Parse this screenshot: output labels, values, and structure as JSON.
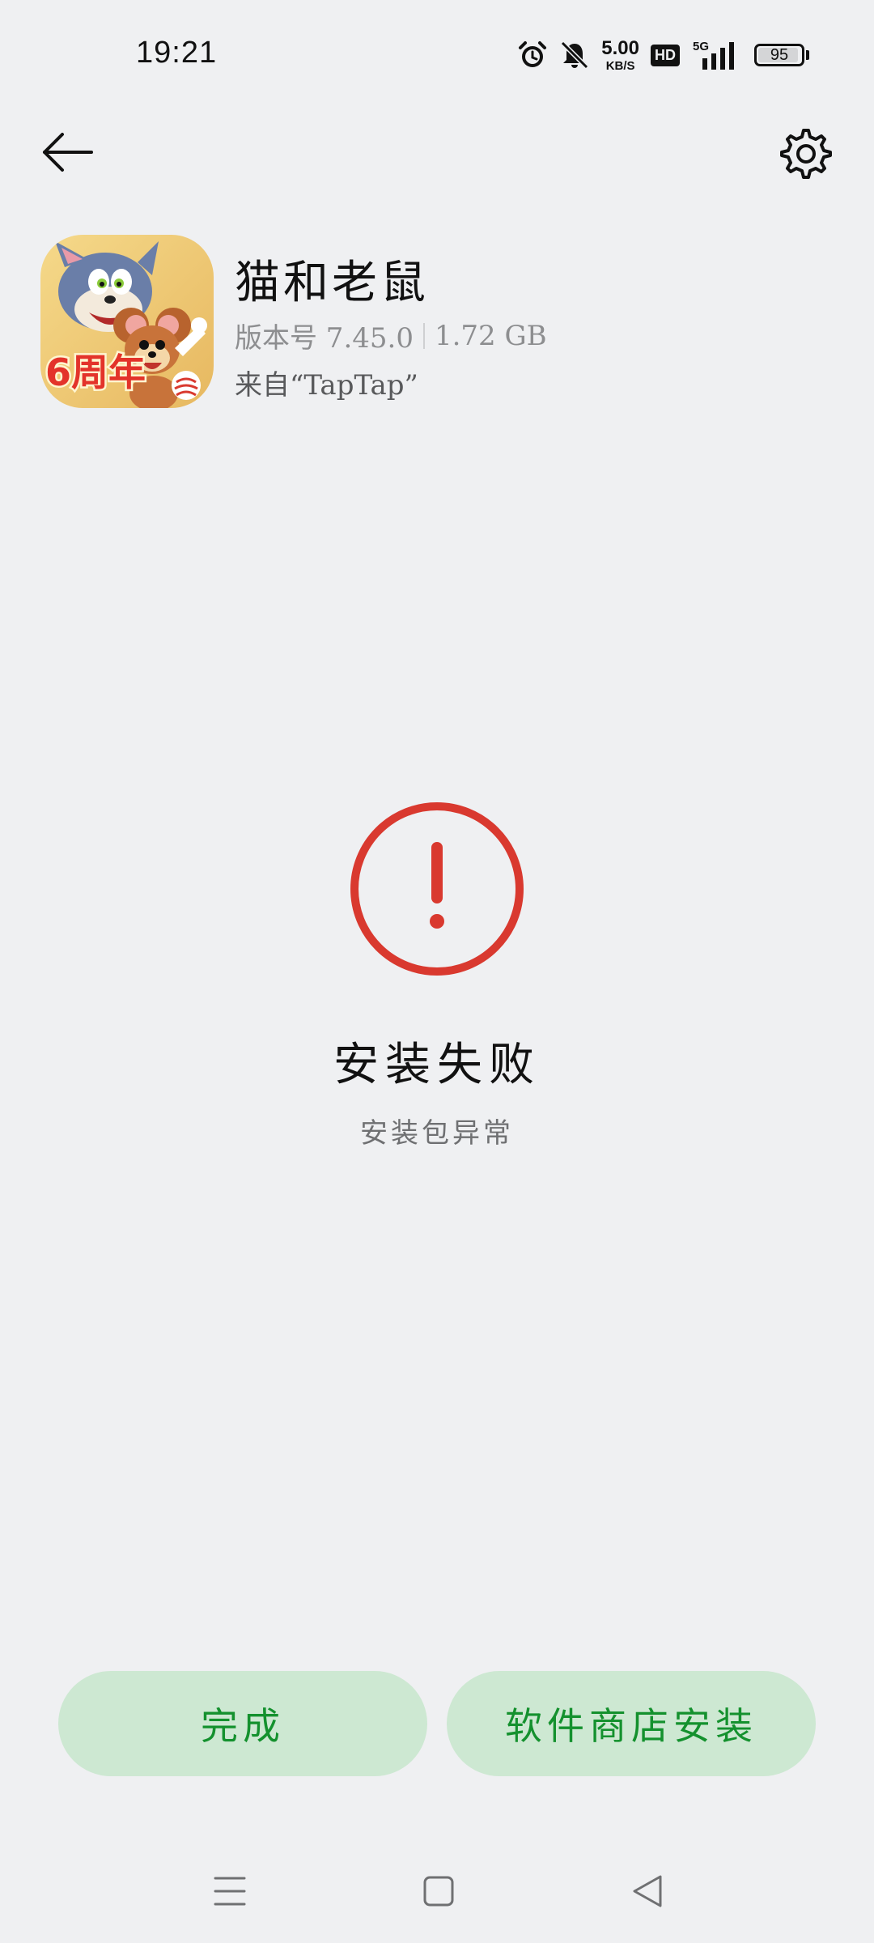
{
  "status_bar": {
    "time": "19:21",
    "net_speed_value": "5.00",
    "net_speed_unit": "KB/S",
    "hd_label": "HD",
    "network_label": "5G",
    "battery_level": "95",
    "icons": [
      "alarm-icon",
      "mute-bell-icon",
      "signal-icon"
    ]
  },
  "top_bar": {
    "back_icon": "arrow-left-icon",
    "settings_icon": "gear-icon"
  },
  "app": {
    "name": "猫和老鼠",
    "version": "版本号 7.45.0",
    "size": "1.72 GB",
    "source": "来自“TapTap”",
    "icon_badge": "6周年"
  },
  "result": {
    "title": "安装失败",
    "subtitle": "安装包异常",
    "accent": "#d9392f"
  },
  "buttons": {
    "done": "完成",
    "store_install": "软件商店安装",
    "bg": "#cde8d2",
    "fg": "#14912e"
  },
  "nav_bar": {
    "items": [
      "menu-icon",
      "home-icon",
      "back-triangle-icon"
    ]
  }
}
